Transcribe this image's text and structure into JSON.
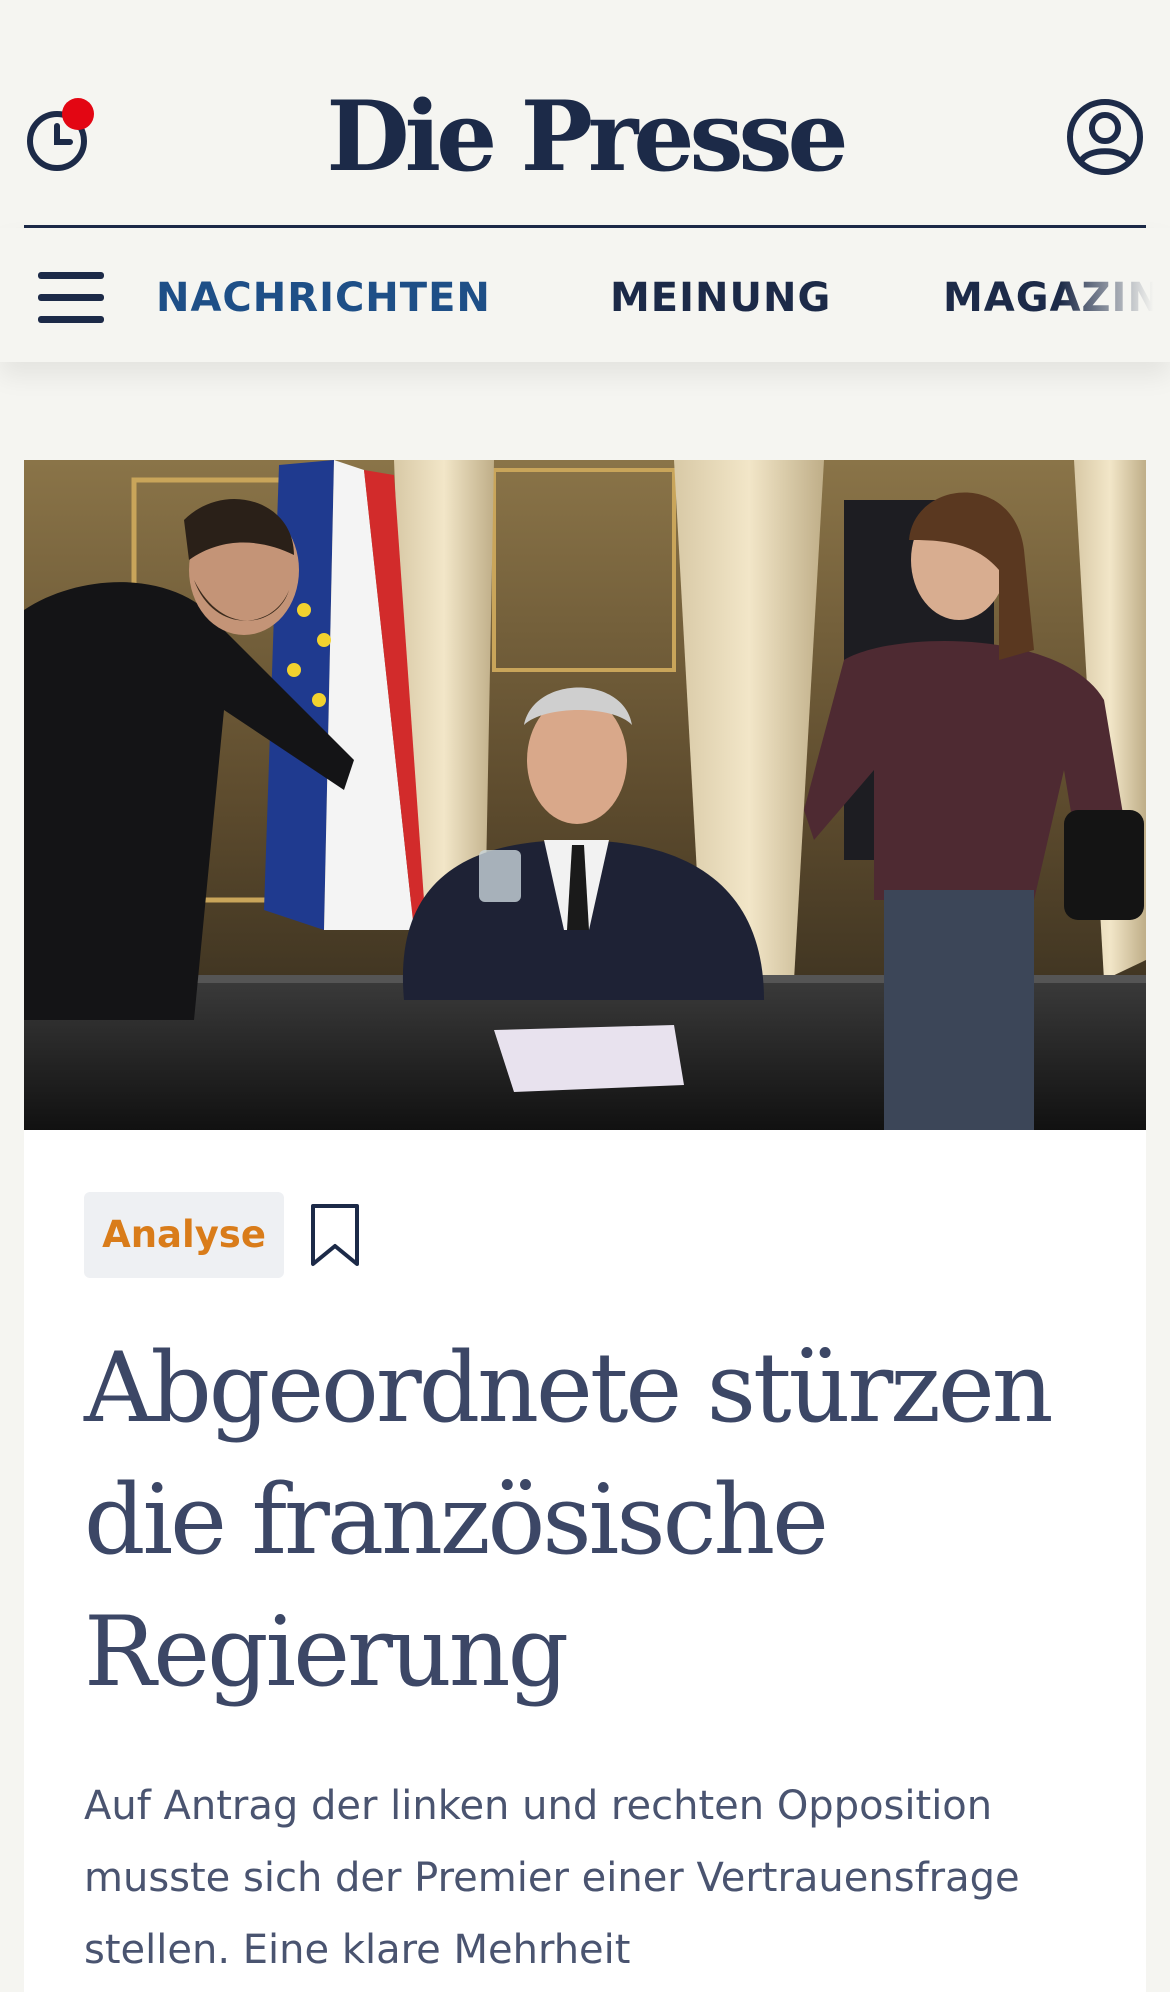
{
  "brand": {
    "name": "Die Presse"
  },
  "header": {
    "history_icon": "clock-history-icon",
    "account_icon": "user-account-icon",
    "menu_icon": "hamburger-menu-icon"
  },
  "nav": {
    "items": [
      {
        "label": "NACHRICHTEN",
        "active": true
      },
      {
        "label": "MEINUNG",
        "active": false
      },
      {
        "label": "MAGAZIN",
        "active": false
      }
    ]
  },
  "article": {
    "tag": "Analyse",
    "bookmark_icon": "bookmark-icon",
    "headline": "Abgeordnete stürzen die französische Regierung",
    "lead": "Auf Antrag der linken und rechten Opposition musste sich der Premier einer Vertrauensfrage stellen. Eine klare Mehrheit"
  },
  "colors": {
    "brand_navy": "#1c2a48",
    "nav_active": "#1e4f87",
    "tag_text": "#d97c1a",
    "notification": "#e30613",
    "page_bg": "#f5f5f1"
  }
}
